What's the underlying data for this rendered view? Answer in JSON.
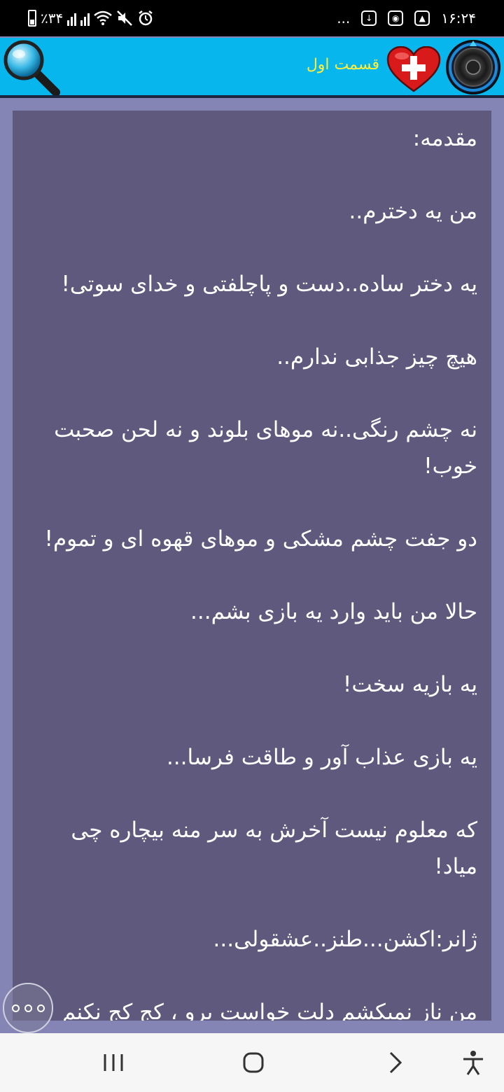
{
  "status_bar": {
    "battery_percent": "٪۳۴",
    "time": "۱۶:۲۴",
    "more_dots": "..."
  },
  "toolbar": {
    "title": "قسمت اول",
    "search_icon": "search-icon",
    "favorite_icon": "heart-plus-icon",
    "settings_icon": "speaker-icon"
  },
  "content": {
    "paragraphs": [
      "مقدمه:",
      "من یه دخترم..",
      "یه دختر ساده..دست و پاچلفتی و خدای سوتی!",
      "هیچ چیز جذابی ندارم..",
      "نه چشم رنگی..نه موهای بلوند و نه لحن صحبت خوب!",
      "دو جفت چشم مشکی و موهای قهوه ای و تموم!",
      "حالا من باید وارد یه بازی بشم...",
      "یه بازیه سخت!",
      "یه بازی عذاب آور و طاقت فرسا...",
      "که معلوم نیست آخرش به سر منه بیچاره چی میاد!",
      "ژانر:اکشن...طنز..عشقولی...",
      "من ناز نمیکشم دلت خواست برو ، کج کج نکنم نگاه و\" یکراست\" برو... هرجور که مایلی بزن قید مرا ، من عاشق گریه و زاری نیستم دیگر زکجا برو"
    ]
  },
  "fab": {
    "icon": "more-dots-icon"
  },
  "nav_bar": {
    "recents_icon": "recents-icon",
    "home_icon": "home-icon",
    "back_icon": "back-icon",
    "accessibility_icon": "accessibility-icon"
  },
  "colors": {
    "toolbar": "#07b6ec",
    "title": "#ffef3a",
    "page_bg": "#8585b5",
    "card_bg": "#5f5a7d"
  }
}
